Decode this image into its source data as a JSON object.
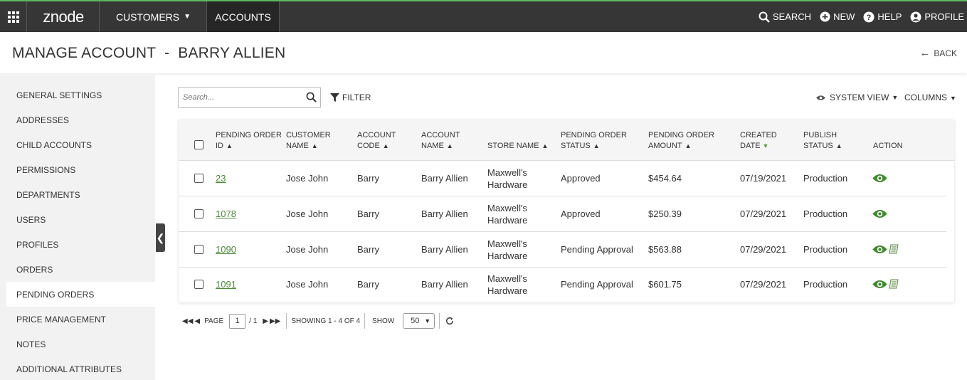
{
  "topbar": {
    "logo_text": "znode",
    "nav": {
      "customers": "CUSTOMERS",
      "accounts": "ACCOUNTS"
    },
    "search": "SEARCH",
    "new": "NEW",
    "help": "HELP",
    "profile": "PROFILE"
  },
  "header": {
    "title": "MANAGE ACCOUNT  -  BARRY ALLIEN",
    "back": "BACK"
  },
  "sidebar": {
    "items": [
      {
        "label": "GENERAL SETTINGS"
      },
      {
        "label": "ADDRESSES"
      },
      {
        "label": "CHILD ACCOUNTS"
      },
      {
        "label": "PERMISSIONS"
      },
      {
        "label": "DEPARTMENTS"
      },
      {
        "label": "USERS"
      },
      {
        "label": "PROFILES"
      },
      {
        "label": "ORDERS"
      },
      {
        "label": "PENDING ORDERS"
      },
      {
        "label": "PRICE MANAGEMENT"
      },
      {
        "label": "NOTES"
      },
      {
        "label": "ADDITIONAL ATTRIBUTES"
      }
    ],
    "active_index": 8
  },
  "toolbar": {
    "search_placeholder": "Search...",
    "filter": "FILTER",
    "system_view": "SYSTEM VIEW",
    "columns": "COLUMNS"
  },
  "table": {
    "headers": {
      "order_id_1": "PENDING ORDER",
      "order_id_2": "ID",
      "customer_1": "CUSTOMER",
      "customer_2": "NAME",
      "acode_1": "ACCOUNT",
      "acode_2": "CODE",
      "aname_1": "ACCOUNT",
      "aname_2": "NAME",
      "store": "STORE NAME",
      "status_1": "PENDING ORDER",
      "status_2": "STATUS",
      "amount_1": "PENDING ORDER",
      "amount_2": "AMOUNT",
      "created_1": "CREATED",
      "created_2": "DATE",
      "publish_1": "PUBLISH",
      "publish_2": "STATUS",
      "action": "ACTION"
    },
    "rows": [
      {
        "id": "23",
        "customer": "Jose John",
        "acode": "Barry",
        "aname": "Barry Allien",
        "store_1": "Maxwell's",
        "store_2": "Hardware",
        "status": "Approved",
        "amount": "$454.64",
        "created": "07/19/2021",
        "publish": "Production",
        "bill": false
      },
      {
        "id": "1078",
        "customer": "Jose John",
        "acode": "Barry",
        "aname": "Barry Allien",
        "store_1": "Maxwell's",
        "store_2": "Hardware",
        "status": "Approved",
        "amount": "$250.39",
        "created": "07/29/2021",
        "publish": "Production",
        "bill": false
      },
      {
        "id": "1090",
        "customer": "Jose John",
        "acode": "Barry",
        "aname": "Barry Allien",
        "store_1": "Maxwell's",
        "store_2": "Hardware",
        "status": "Pending Approval",
        "amount": "$563.88",
        "created": "07/29/2021",
        "publish": "Production",
        "bill": true
      },
      {
        "id": "1091",
        "customer": "Jose John",
        "acode": "Barry",
        "aname": "Barry Allien",
        "store_1": "Maxwell's",
        "store_2": "Hardware",
        "status": "Pending Approval",
        "amount": "$601.75",
        "created": "07/29/2021",
        "publish": "Production",
        "bill": true
      }
    ]
  },
  "pager": {
    "page_label": "PAGE",
    "page": "1",
    "of": "/ 1",
    "showing": "SHOWING 1 - 4 OF 4",
    "show_label": "SHOW",
    "show_value": "50"
  },
  "colors": {
    "accent_green": "#4a8a36",
    "topbar": "#363636",
    "brand_line": "#5cb85c"
  }
}
